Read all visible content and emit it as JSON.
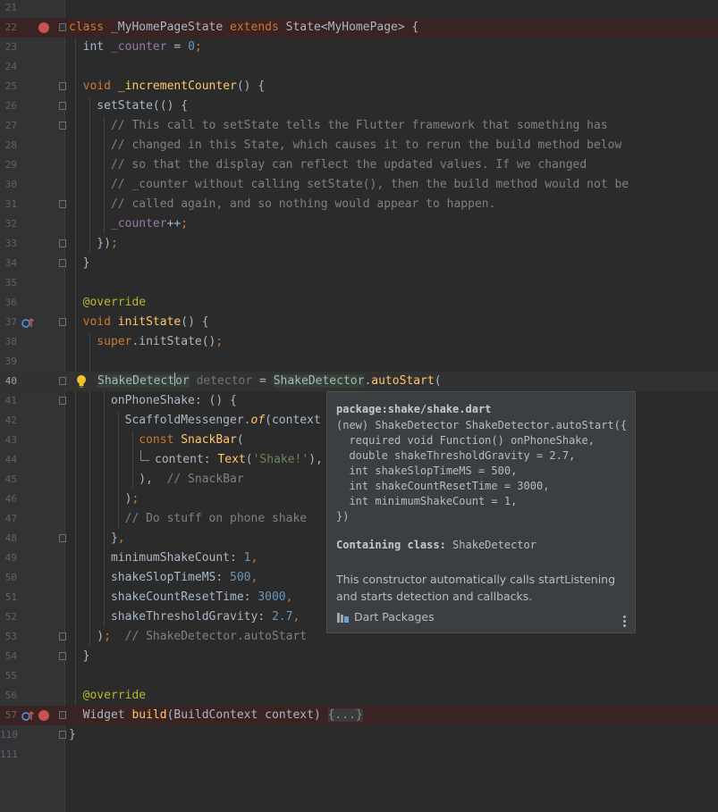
{
  "gutter": {
    "line_numbers": [
      "21",
      "22",
      "23",
      "24",
      "25",
      "26",
      "27",
      "28",
      "29",
      "30",
      "31",
      "32",
      "33",
      "34",
      "35",
      "36",
      "37",
      "38",
      "39",
      "40",
      "41",
      "42",
      "43",
      "44",
      "45",
      "46",
      "47",
      "48",
      "49",
      "50",
      "51",
      "52",
      "53",
      "54",
      "55",
      "56",
      "57",
      "110",
      "111"
    ]
  },
  "code": {
    "l22": {
      "kw1": "class",
      "name": " _MyHomePageState ",
      "kw2": "extends",
      "rest": " State<MyHomePage> {"
    },
    "l23": {
      "t": "  int ",
      "f": "_counter",
      "eq": " = ",
      "n": "0",
      "semi": ";"
    },
    "l25": {
      "kw": "  void ",
      "fn": "_incrementCounter",
      "rest": "() {"
    },
    "l26": {
      "t": "    setState(() {"
    },
    "l27": {
      "c": "      // This call to setState tells the Flutter framework that something has"
    },
    "l28": {
      "c": "      // changed in this State, which causes it to rerun the build method below"
    },
    "l29": {
      "c": "      // so that the display can reflect the updated values. If we changed"
    },
    "l30": {
      "c": "      // _counter without calling setState(), then the build method would not be"
    },
    "l31": {
      "c": "      // called again, and so nothing would appear to happen."
    },
    "l32": {
      "f": "      _counter",
      "rest": "++",
      "semi": ";"
    },
    "l33": {
      "t": "    })",
      "semi": ";"
    },
    "l34": {
      "t": "  }"
    },
    "l36": {
      "a": "  @override"
    },
    "l37": {
      "kw": "  void ",
      "fn": "initState",
      "rest": "() {"
    },
    "l38": {
      "kw": "    super",
      "rest": ".initState()",
      "semi": ";"
    },
    "l40": {
      "t1a": "ShakeDetect",
      "t1b": "or",
      "var": " detector",
      "eq": " = ",
      "t2": "ShakeDetector",
      "dot": ".",
      "fn": "autoStart",
      "rest": "("
    },
    "l41": {
      "t": "      onPhoneShake: () {"
    },
    "l42": {
      "t": "        ScaffoldMessenger.",
      "fn": "of",
      "rest": "(context"
    },
    "l43": {
      "kw": "          const ",
      "fn": "SnackBar",
      "rest": "("
    },
    "l44": {
      "t": "content: ",
      "fn": "Text",
      "p": "(",
      "s": "'Shake!'",
      "rest": "),"
    },
    "l45": {
      "t": "          ),  ",
      "c": "// SnackBar"
    },
    "l46": {
      "t": "        )",
      "semi": ";"
    },
    "l47": {
      "c": "        // Do stuff on phone shake"
    },
    "l48": {
      "t": "      }",
      "semi": ","
    },
    "l49": {
      "t": "      minimumShakeCount: ",
      "n": "1",
      "semi": ","
    },
    "l50": {
      "t": "      shakeSlopTimeMS: ",
      "n": "500",
      "semi": ","
    },
    "l51": {
      "t": "      shakeCountResetTime: ",
      "n": "3000",
      "semi": ","
    },
    "l52": {
      "t": "      shakeThresholdGravity: ",
      "n": "2.7",
      "semi": ","
    },
    "l53": {
      "t": "    )",
      "semi": ";",
      "c": "  // ShakeDetector.autoStart"
    },
    "l54": {
      "t": "  }"
    },
    "l56": {
      "a": "  @override"
    },
    "l57": {
      "t": "  Widget ",
      "fn": "build",
      "rest": "(BuildContext context) ",
      "fold": "{...}"
    },
    "l110": {
      "t": "}"
    }
  },
  "popup": {
    "package": "package:shake/shake.dart",
    "signature": "(new) ShakeDetector ShakeDetector.autoStart({\n  required void Function() onPhoneShake,\n  double shakeThresholdGravity = 2.7,\n  int shakeSlopTimeMS = 500,\n  int shakeCountResetTime = 3000,\n  int minimumShakeCount = 1,\n})",
    "containing_label": "Containing class:",
    "containing_value": " ShakeDetector",
    "description": "This constructor automatically calls startListening and starts detection and callbacks.",
    "source": "Dart Packages"
  },
  "colors": {
    "background": "#2b2b2b",
    "keyword": "#cc7832",
    "function": "#ffc66d",
    "number": "#6897bb",
    "string": "#6a8759",
    "comment": "#808080",
    "field": "#9876aa",
    "breakpoint": "#c75450"
  }
}
